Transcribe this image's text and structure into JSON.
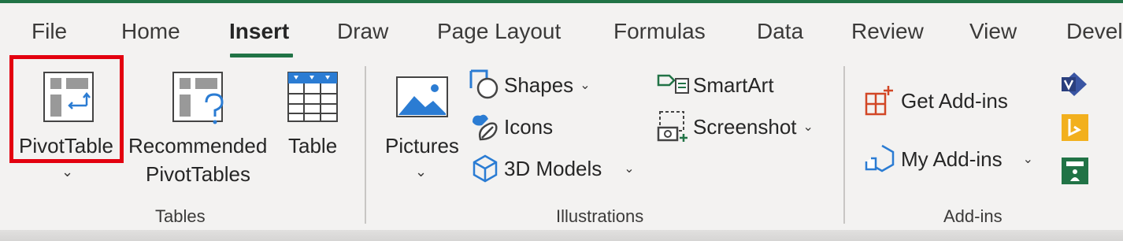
{
  "tabs": [
    "File",
    "Home",
    "Insert",
    "Draw",
    "Page Layout",
    "Formulas",
    "Data",
    "Review",
    "View",
    "Devel"
  ],
  "active_tab": "Insert",
  "groups": {
    "tables": {
      "label": "Tables",
      "pivottable": "PivotTable",
      "recommended_line1": "Recommended",
      "recommended_line2": "PivotTables",
      "table": "Table"
    },
    "illustrations": {
      "label": "Illustrations",
      "pictures": "Pictures",
      "shapes": "Shapes",
      "icons": "Icons",
      "models": "3D Models",
      "smartart": "SmartArt",
      "screenshot": "Screenshot"
    },
    "addins": {
      "label": "Add-ins",
      "get": "Get Add-ins",
      "my": "My Add-ins"
    }
  },
  "colors": {
    "accent_green": "#217346",
    "highlight_red": "#e3000f",
    "icon_blue": "#2b7cd3",
    "addins_orange": "#d24726"
  },
  "highlighted_control": "PivotTable"
}
